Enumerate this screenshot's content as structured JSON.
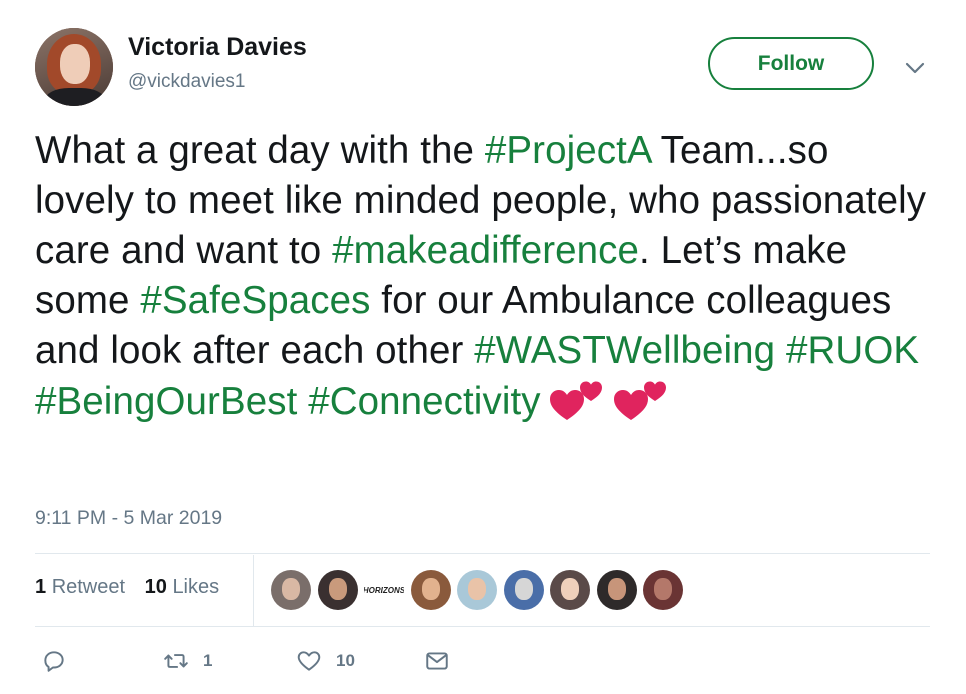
{
  "author": {
    "name": "Victoria Davies",
    "handle": "@vickdavies1",
    "avatar_icon": "profile-photo"
  },
  "follow_label": "Follow",
  "tweet": {
    "segments": [
      {
        "text": "What a great day with the ",
        "hashtag": false
      },
      {
        "text": "#ProjectA",
        "hashtag": true
      },
      {
        "text": " Team...so lovely to meet like minded people, who passionately care and want to ",
        "hashtag": false
      },
      {
        "text": "#makeadifference",
        "hashtag": true
      },
      {
        "text": ". Let’s make some ",
        "hashtag": false
      },
      {
        "text": "#SafeSpaces",
        "hashtag": true
      },
      {
        "text": " for our Ambulance colleagues and look after each other ",
        "hashtag": false
      },
      {
        "text": "#WASTWellbeing",
        "hashtag": true
      },
      {
        "text": " ",
        "hashtag": false
      },
      {
        "text": "#RUOK",
        "hashtag": true
      },
      {
        "text": " ",
        "hashtag": false
      },
      {
        "text": "#BeingOurBest",
        "hashtag": true
      },
      {
        "text": " ",
        "hashtag": false
      },
      {
        "text": "#Connectivity",
        "hashtag": true
      }
    ],
    "emoji": [
      "two-hearts-emoji",
      "two-hearts-emoji"
    ]
  },
  "timestamp": "9:11 PM - 5 Mar 2019",
  "stats": {
    "retweets_count": "1",
    "retweets_label": "Retweet",
    "likes_count": "10",
    "likes_label": "Likes"
  },
  "likers": [
    {
      "kind": "photo",
      "bg": "#7a6e6a",
      "face": "#d9b8a4"
    },
    {
      "kind": "photo",
      "bg": "#3a3030",
      "face": "#c99a7c"
    },
    {
      "kind": "logo",
      "text": "HORIZONS"
    },
    {
      "kind": "photo",
      "bg": "#8a5a3c",
      "face": "#e2b28e"
    },
    {
      "kind": "photo",
      "bg": "#a9c8d8",
      "face": "#e9c3a8"
    },
    {
      "kind": "photo",
      "bg": "#4a6ea8",
      "face": "#d6d6d6"
    },
    {
      "kind": "photo",
      "bg": "#5a4a48",
      "face": "#efd0bb"
    },
    {
      "kind": "photo",
      "bg": "#2e2a2a",
      "face": "#c7957a"
    },
    {
      "kind": "photo",
      "bg": "#6a3434",
      "face": "#b4786a"
    }
  ],
  "actions": {
    "reply_count": "",
    "retweet_count": "1",
    "like_count": "10"
  },
  "colors": {
    "accent": "#17803d",
    "text": "#14171a",
    "muted": "#657786",
    "divider": "#e1e8ed",
    "heart": "#e0245e"
  }
}
